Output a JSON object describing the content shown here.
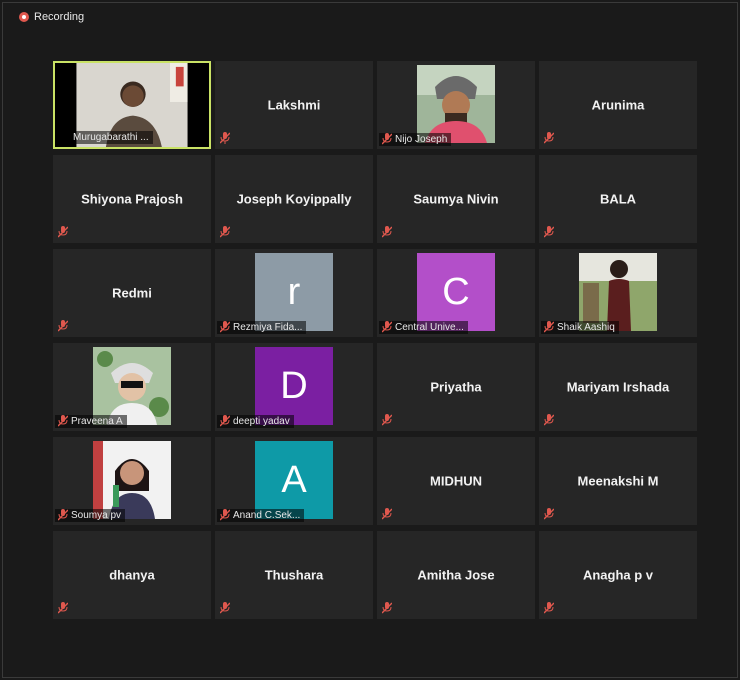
{
  "recording": {
    "label": "Recording"
  },
  "colors": {
    "active_border": "#c9e265",
    "mic_muted": "#e0584e",
    "tile_bg": "#262626"
  },
  "participants": [
    {
      "name": "Murugabarathi ...",
      "kind": "video"
    },
    {
      "name": "Lakshmi",
      "kind": "name"
    },
    {
      "name": "Nijo Joseph",
      "kind": "photo"
    },
    {
      "name": "Arunima",
      "kind": "name"
    },
    {
      "name": "Shiyona Prajosh",
      "kind": "name"
    },
    {
      "name": "Joseph Koyippally",
      "kind": "name"
    },
    {
      "name": "Saumya Nivin",
      "kind": "name"
    },
    {
      "name": "BALA",
      "kind": "name"
    },
    {
      "name": "Redmi",
      "kind": "name"
    },
    {
      "name": "Rezmiya Fida...",
      "kind": "letter",
      "letter": "r",
      "color": "#8d9ba6"
    },
    {
      "name": "Central Unive...",
      "kind": "letter",
      "letter": "C",
      "color": "#b34fc9"
    },
    {
      "name": "Shaik Aashiq",
      "kind": "photo"
    },
    {
      "name": "Praveena A",
      "kind": "photo"
    },
    {
      "name": "deepti yadav",
      "kind": "letter",
      "letter": "D",
      "color": "#7b1fa2"
    },
    {
      "name": "Priyatha",
      "kind": "name"
    },
    {
      "name": "Mariyam Irshada",
      "kind": "name"
    },
    {
      "name": "Soumya pv",
      "kind": "photo"
    },
    {
      "name": "Anand C.Sek...",
      "kind": "letter",
      "letter": "A",
      "color": "#0e9aa7"
    },
    {
      "name": "MIDHUN",
      "kind": "name"
    },
    {
      "name": "Meenakshi M",
      "kind": "name"
    },
    {
      "name": "dhanya",
      "kind": "name"
    },
    {
      "name": "Thushara",
      "kind": "name"
    },
    {
      "name": "Amitha Jose",
      "kind": "name"
    },
    {
      "name": "Anagha p v",
      "kind": "name"
    }
  ]
}
